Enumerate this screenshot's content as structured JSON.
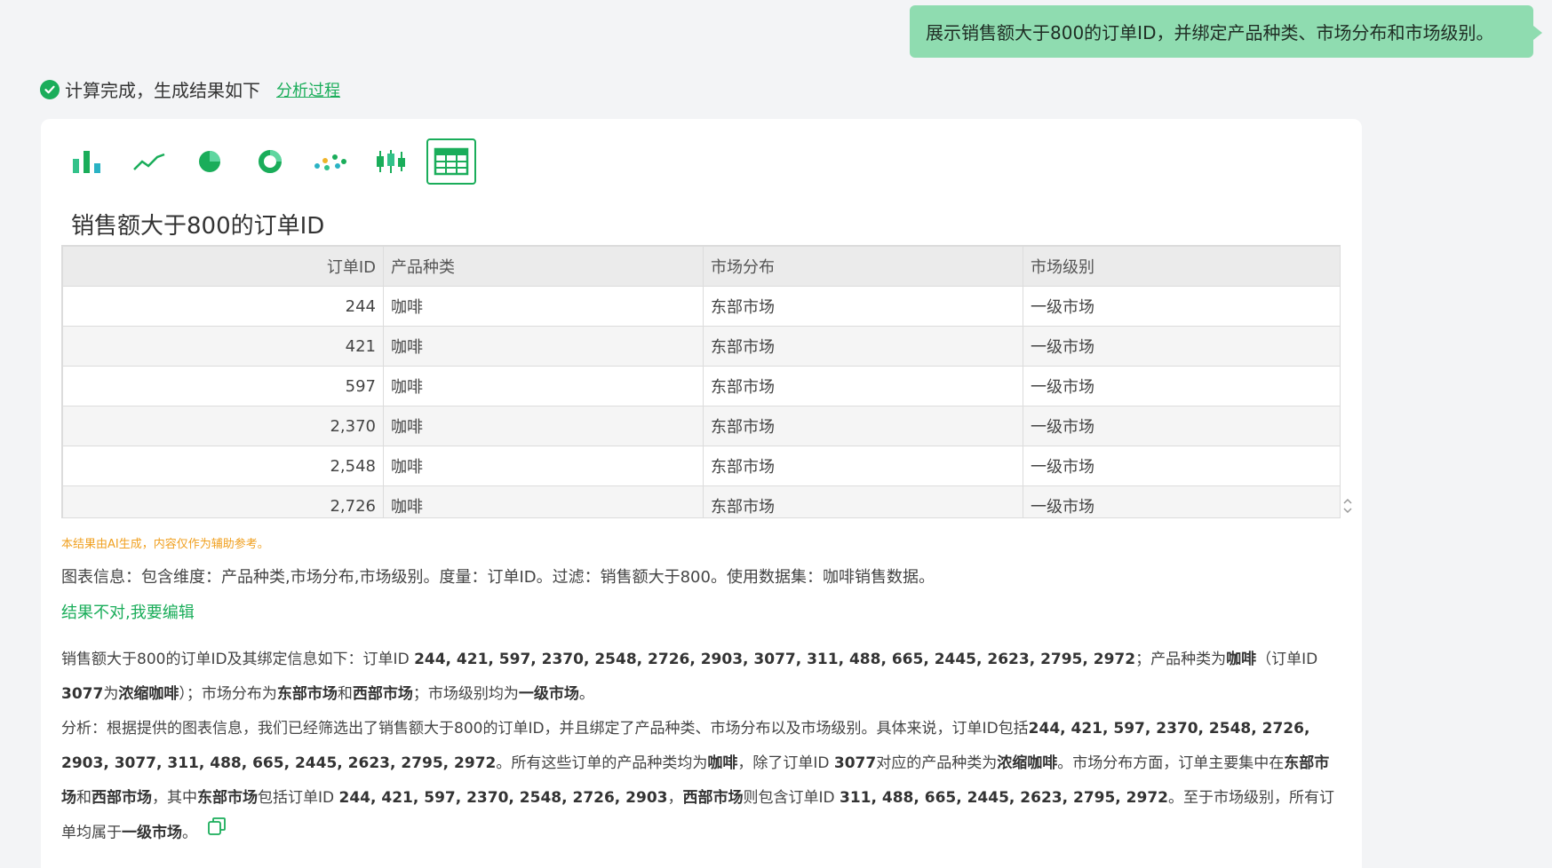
{
  "user_message": "展示销售额大于800的订单ID，并绑定产品种类、市场分布和市场级别。",
  "status": {
    "text": "计算完成，生成结果如下",
    "link": "分析过程"
  },
  "toolbar": {
    "icons": [
      "bar-chart-icon",
      "line-chart-icon",
      "pie-chart-icon",
      "donut-chart-icon",
      "scatter-chart-icon",
      "boxplot-chart-icon",
      "table-icon"
    ],
    "active": "table-icon"
  },
  "table": {
    "title": "销售额大于800的订单ID",
    "columns": [
      "订单ID",
      "产品种类",
      "市场分布",
      "市场级别"
    ],
    "rows": [
      [
        "244",
        "咖啡",
        "东部市场",
        "一级市场"
      ],
      [
        "421",
        "咖啡",
        "东部市场",
        "一级市场"
      ],
      [
        "597",
        "咖啡",
        "东部市场",
        "一级市场"
      ],
      [
        "2,370",
        "咖啡",
        "东部市场",
        "一级市场"
      ],
      [
        "2,548",
        "咖啡",
        "东部市场",
        "一级市场"
      ],
      [
        "2,726",
        "咖啡",
        "东部市场",
        "一级市场"
      ]
    ]
  },
  "disclaimer": "本结果由AI生成，内容仅作为辅助参考。",
  "chart_info": "图表信息：包含维度：产品种类,市场分布,市场级别。度量：订单ID。过滤：销售额大于800。使用数据集：咖啡销售数据。",
  "edit_link": "结果不对,我要编辑",
  "summary": {
    "p1_a": "销售额大于800的订单ID及其绑定信息如下：订单ID ",
    "p1_ids": "244, 421, 597, 2370, 2548, 2726, 2903, 3077, 311, 488, 665, 2445, 2623, 2795, 2972",
    "p1_b": "；产品种类为",
    "p1_coffee": "咖啡",
    "p1_c": "（订单ID ",
    "p1_id3077": "3077",
    "p1_d": "为",
    "p1_espresso": "浓缩咖啡",
    "p1_e": "）；市场分布为",
    "p1_east": "东部市场",
    "p1_f": "和",
    "p1_west": "西部市场",
    "p1_g": "；市场级别均为",
    "p1_tier": "一级市场",
    "p1_h": "。",
    "p2_a": "分析：根据提供的图表信息，我们已经筛选出了销售额大于800的订单ID，并且绑定了产品种类、市场分布以及市场级别。具体来说，订单ID包括",
    "p2_ids": "244, 421, 597, 2370, 2548, 2726, 2903, 3077, 311, 488, 665, 2445, 2623, 2795, 2972",
    "p2_b": "。所有这些订单的产品种类均为",
    "p2_coffee": "咖啡",
    "p2_c": "，除了订单ID ",
    "p2_id3077": "3077",
    "p2_d": "对应的产品种类为",
    "p2_espresso": "浓缩咖啡",
    "p2_e": "。市场分布方面，订单主要集中在",
    "p2_east": "东部市场",
    "p2_f": "和",
    "p2_west": "西部市场",
    "p2_g": "，其中",
    "p2_east2": "东部市场",
    "p2_h": "包括订单ID ",
    "p2_east_ids": "244, 421, 597, 2370, 2548, 2726, 2903",
    "p2_i": "，",
    "p2_west2": "西部市场",
    "p2_j": "则包含订单ID ",
    "p2_west_ids": "311, 488, 665, 2445, 2623, 2795, 2972",
    "p2_k": "。至于市场级别，所有订单均属于",
    "p2_tier": "一级市场",
    "p2_l": "。"
  },
  "colors": {
    "accent": "#1aad5a",
    "bubble": "#8fdcb0",
    "warning": "#f0a020"
  }
}
